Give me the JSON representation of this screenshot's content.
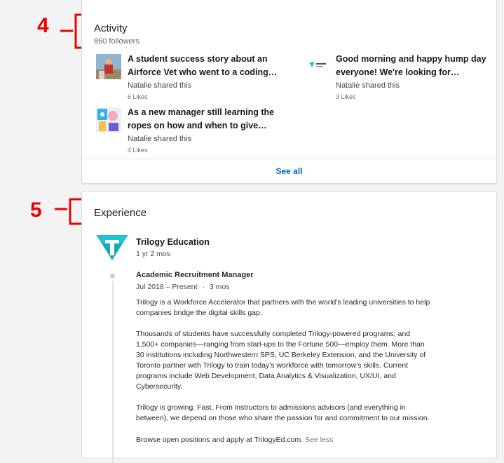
{
  "annotations": {
    "activity_number": "4",
    "experience_number": "5",
    "color": "#ee0000"
  },
  "activity": {
    "title": "Activity",
    "followers": "860 followers",
    "posts": [
      {
        "title_line1": "A student success story about an",
        "title_line2": "Airforce Vet who went to a coding…",
        "shared": "Natalie shared this",
        "likes": "6 Likes",
        "thumb_icon": "veteran-photo-thumbnail"
      },
      {
        "title_line1": "Good morning and happy hump day",
        "title_line2": "everyone! We're looking for…",
        "shared": "Natalie shared this",
        "likes": "3 Likes",
        "thumb_icon": "trilogy-logo-thumbnail"
      },
      {
        "title_line1": "As a new manager still learning the",
        "title_line2": "ropes on how and when to give…",
        "shared": "Natalie shared this",
        "likes": "4 Likes",
        "thumb_icon": "colorful-illustration-thumbnail"
      }
    ],
    "see_all": "See all"
  },
  "experience": {
    "title": "Experience",
    "company": "Trilogy Education",
    "company_duration": "1 yr 2 mos",
    "company_logo": "trilogy-t-logo",
    "role": {
      "title": "Academic Recruitment Manager",
      "dates": "Jul 2018 – Present",
      "separator": "·",
      "duration": "3 mos",
      "desc1": [
        "Trilogy is a Workforce Accelerator that partners with the world's leading universities to help",
        "companies bridge the digital skills gap."
      ],
      "desc2": [
        "Thousands of students have successfully completed Trilogy-powered programs, and",
        "1,500+ companies—ranging from start-ups to the Fortune 500—employ them. More than",
        "30 institutions including Northwestern SPS, UC Berkeley Extension, and the University of",
        "Toronto partner with Trilogy to train today's workforce with tomorrow's skills. Current",
        "programs include Web Development, Data Analytics & Visualization, UX/UI, and",
        "Cybersecurity."
      ],
      "desc3": [
        "Trilogy is growing. Fast. From instructors to admissions advisors (and everything in",
        "between), we depend on those who share the passion for and commitment to our mission."
      ],
      "desc4": "Browse open positions and apply at TrilogyEd.com.",
      "see_less": "See less"
    }
  },
  "colors": {
    "link": "#0a66c2",
    "trilogy_teal": "#1fc3d6",
    "annotation_red": "#ee0000"
  }
}
